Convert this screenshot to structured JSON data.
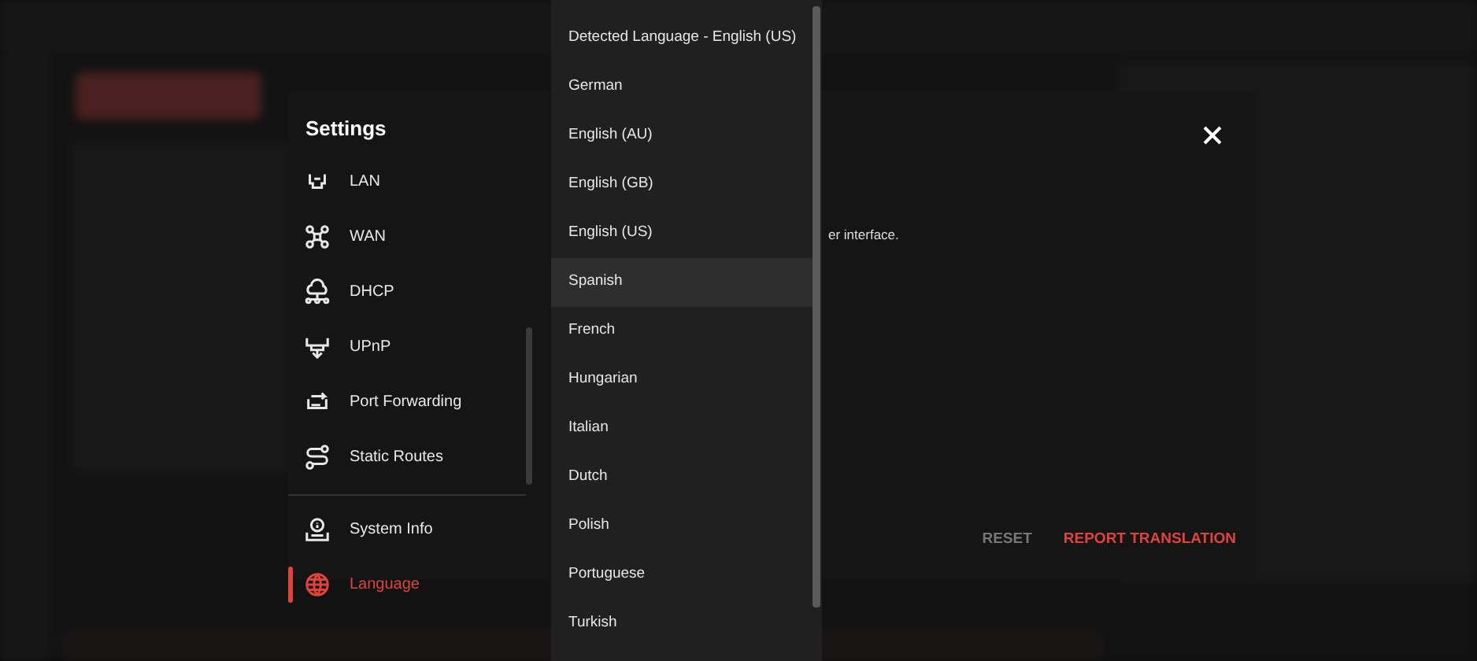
{
  "settings_dialog": {
    "title": "Settings",
    "sidebar": [
      {
        "label": "LAN",
        "selected": false
      },
      {
        "label": "WAN",
        "selected": false
      },
      {
        "label": "DHCP",
        "selected": false
      },
      {
        "label": "UPnP",
        "selected": false
      },
      {
        "label": "Port Forwarding",
        "selected": false
      },
      {
        "label": "Static Routes",
        "selected": false
      },
      {
        "label": "System Info",
        "selected": false,
        "divider_before": true
      },
      {
        "label": "Language",
        "selected": true
      }
    ],
    "description": "er interface.",
    "buttons": [
      {
        "label": "RESET",
        "kind": "secondary"
      },
      {
        "label": "REPORT TRANSLATION",
        "kind": "primary"
      }
    ]
  },
  "language_dropdown": [
    {
      "label": "Detected Language - English (US)",
      "selected": false
    },
    {
      "label": "German",
      "selected": false
    },
    {
      "label": "English (AU)",
      "selected": false
    },
    {
      "label": "English (GB)",
      "selected": false
    },
    {
      "label": "English (US)",
      "selected": false
    },
    {
      "label": "Spanish",
      "selected": true
    },
    {
      "label": "French",
      "selected": false
    },
    {
      "label": "Hungarian",
      "selected": false
    },
    {
      "label": "Italian",
      "selected": false
    },
    {
      "label": "Dutch",
      "selected": false
    },
    {
      "label": "Polish",
      "selected": false
    },
    {
      "label": "Portuguese",
      "selected": false
    },
    {
      "label": "Turkish",
      "selected": false
    }
  ]
}
